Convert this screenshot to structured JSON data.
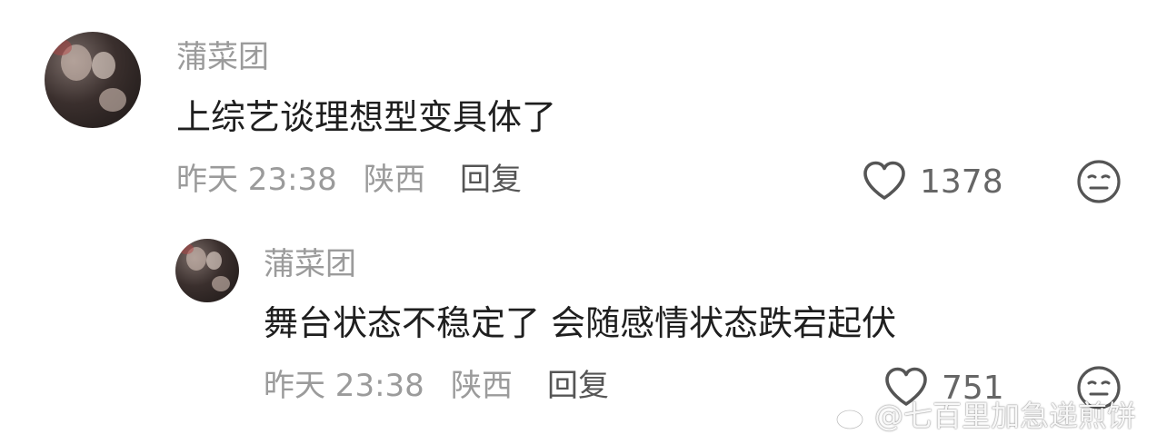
{
  "colors": {
    "meta_gray": "#9b9b9b",
    "content_dark": "#1f1f1f",
    "icon_gray": "#555555"
  },
  "comment": {
    "username": "蒲菜团",
    "text": "上综艺谈理想型变具体了",
    "time": "昨天 23:38",
    "location": "陕西",
    "reply_label": "回复",
    "like_count": "1378",
    "like_icon": "heart-outline-icon",
    "emoji_icon": "neutral-face-icon"
  },
  "reply": {
    "username": "蒲菜团",
    "text": "舞台状态不稳定了 会随感情状态跌宕起伏",
    "time": "昨天 23:38",
    "location": "陕西",
    "reply_label": "回复",
    "like_count": "751",
    "like_icon": "heart-outline-icon",
    "emoji_icon": "neutral-face-icon"
  },
  "watermark": {
    "text": "@七百里加急递煎饼",
    "icon": "weibo-logo-icon"
  }
}
